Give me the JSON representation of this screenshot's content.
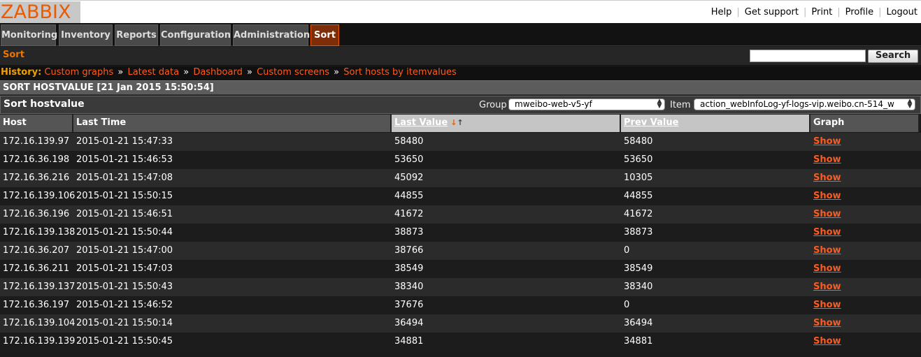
{
  "brand": {
    "logo_text": "ZABBIX",
    "accent": "#ec5a00"
  },
  "toplinks": [
    "Help",
    "Get support",
    "Print",
    "Profile",
    "Logout"
  ],
  "menu": [
    "Monitoring",
    "Inventory",
    "Reports",
    "Configuration",
    "Administration",
    "Sort"
  ],
  "submenu": {
    "active": "Sort",
    "search_button": "Search",
    "search_value": ""
  },
  "history": {
    "label": "History:",
    "items": [
      "Custom graphs",
      "Latest data",
      "Dashboard",
      "Custom screens",
      "Sort hosts by itemvalues"
    ],
    "separator": "»"
  },
  "page_header": "SORT HOSTVALUE [21 Jan 2015 15:50:54]",
  "filter": {
    "title": "Sort hostvalue",
    "group_label": "Group",
    "group_value": "mweibo-web-v5-yf",
    "item_label": "Item",
    "item_value": "action_webInfoLog-yf-logs-vip.weibo.cn-514_w"
  },
  "table": {
    "headers": [
      "Host",
      "Last Time",
      "Last Value",
      "Prev Value",
      "Graph"
    ],
    "sorted_column": "Last Value",
    "rows": [
      [
        "172.16.139.97",
        "2015-01-21 15:47:33",
        "58480",
        "58480",
        "Show"
      ],
      [
        "172.16.36.198",
        "2015-01-21 15:46:53",
        "53650",
        "53650",
        "Show"
      ],
      [
        "172.16.36.216",
        "2015-01-21 15:47:08",
        "45092",
        "10305",
        "Show"
      ],
      [
        "172.16.139.106",
        "2015-01-21 15:50:15",
        "44855",
        "44855",
        "Show"
      ],
      [
        "172.16.36.196",
        "2015-01-21 15:46:51",
        "41672",
        "41672",
        "Show"
      ],
      [
        "172.16.139.138",
        "2015-01-21 15:50:44",
        "38873",
        "38873",
        "Show"
      ],
      [
        "172.16.36.207",
        "2015-01-21 15:47:00",
        "38766",
        "0",
        "Show"
      ],
      [
        "172.16.36.211",
        "2015-01-21 15:47:03",
        "38549",
        "38549",
        "Show"
      ],
      [
        "172.16.139.137",
        "2015-01-21 15:50:43",
        "38340",
        "38340",
        "Show"
      ],
      [
        "172.16.36.197",
        "2015-01-21 15:46:52",
        "37676",
        "0",
        "Show"
      ],
      [
        "172.16.139.104",
        "2015-01-21 15:50:14",
        "36494",
        "36494",
        "Show"
      ],
      [
        "172.16.139.139",
        "2015-01-21 15:50:45",
        "34881",
        "34881",
        "Show"
      ]
    ]
  }
}
